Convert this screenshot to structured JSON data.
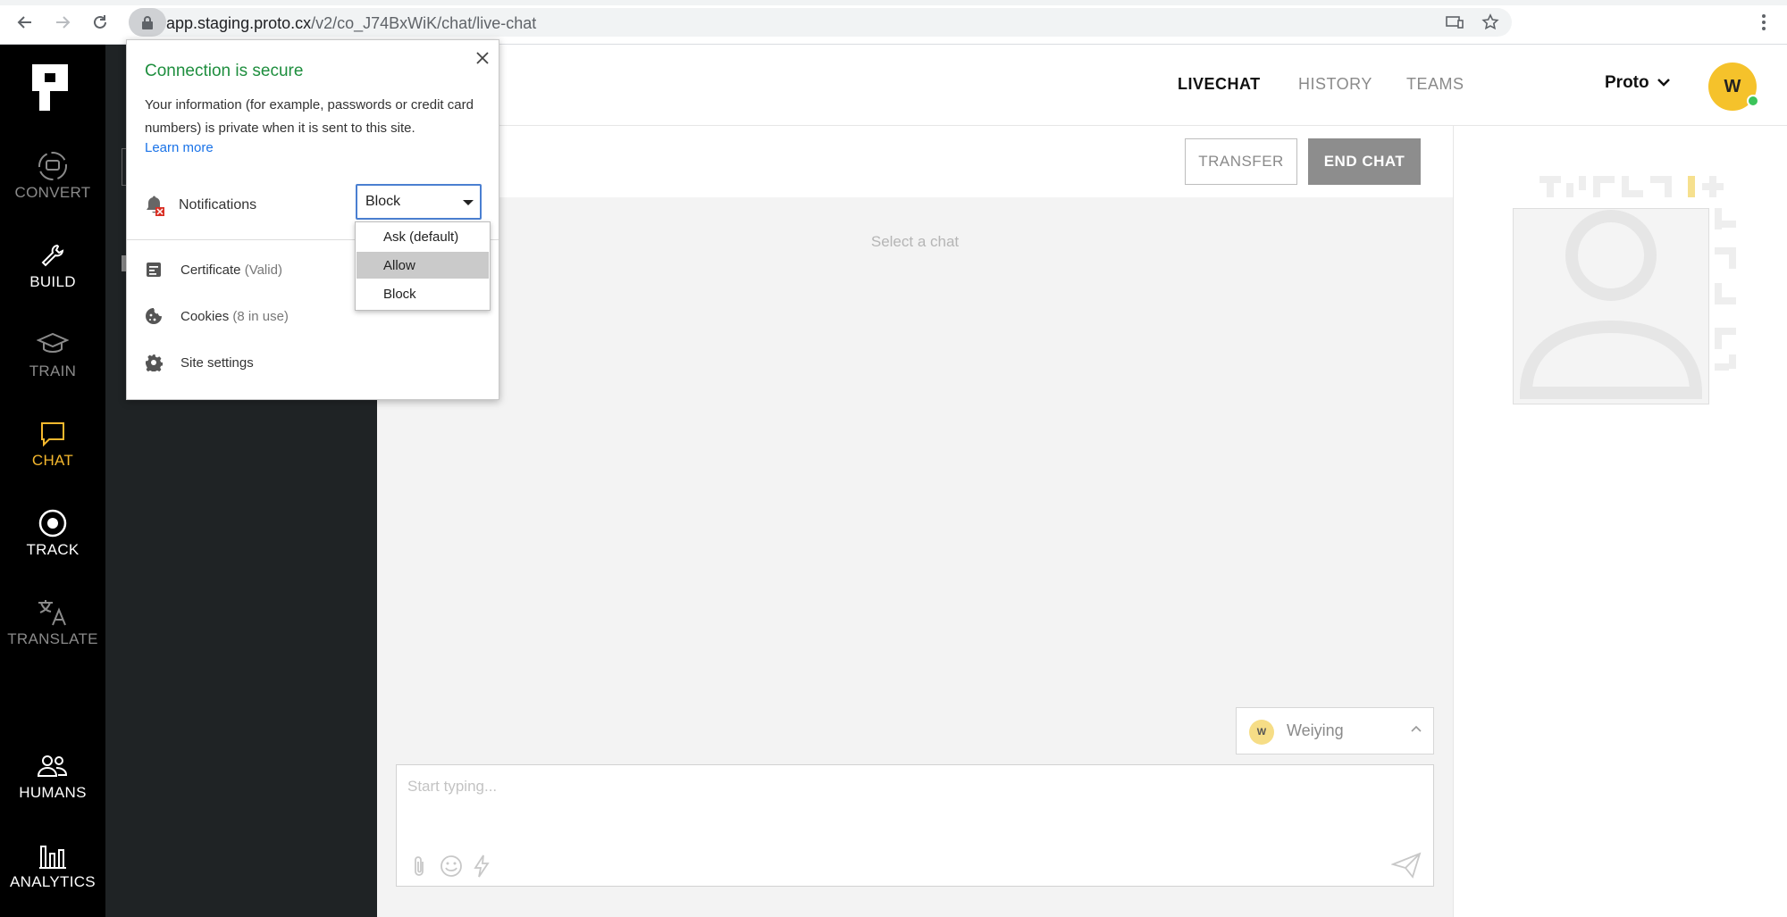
{
  "browser": {
    "url_host": "app.staging.proto.cx",
    "url_path": "/v2/co_J74BxWiK/chat/live-chat"
  },
  "leftnav": {
    "items": [
      {
        "label": "CONVERT",
        "icon": "chat-convert-icon"
      },
      {
        "label": "BUILD",
        "icon": "wrench-icon"
      },
      {
        "label": "TRAIN",
        "icon": "graduation-cap-icon"
      },
      {
        "label": "CHAT",
        "icon": "chat-bubble-icon"
      },
      {
        "label": "TRACK",
        "icon": "target-icon"
      },
      {
        "label": "TRANSLATE",
        "icon": "translate-icon"
      },
      {
        "label": "HUMANS",
        "icon": "people-icon"
      },
      {
        "label": "ANALYTICS",
        "icon": "bar-chart-icon"
      }
    ]
  },
  "header": {
    "tabs": [
      {
        "label": "LIVECHAT",
        "active": true
      },
      {
        "label": "HISTORY",
        "active": false
      },
      {
        "label": "TEAMS",
        "active": false
      }
    ],
    "user_menu": "Proto",
    "avatar_initial": "W"
  },
  "chat": {
    "transfer_label": "TRANSFER",
    "end_chat_label": "END CHAT",
    "empty_text": "Select a chat",
    "agent_initial": "W",
    "agent_name": "Weiying",
    "composer_placeholder": "Start typing..."
  },
  "popup": {
    "title": "Connection is secure",
    "description": "Your information (for example, passwords or credit card numbers) is private when it is sent to this site.",
    "learn_more": "Learn more",
    "notifications_label": "Notifications",
    "notifications_value": "Block",
    "options": [
      "Ask (default)",
      "Allow",
      "Block"
    ],
    "highlighted_option": "Allow",
    "certificate_label": "Certificate",
    "certificate_status": "(Valid)",
    "cookies_label": "Cookies",
    "cookies_status": "(8 in use)",
    "site_settings_label": "Site settings"
  },
  "colors": {
    "accent": "#f5b82e",
    "secure_green": "#1e8e3e",
    "link_blue": "#1a73e8",
    "online": "#3bc45a"
  }
}
